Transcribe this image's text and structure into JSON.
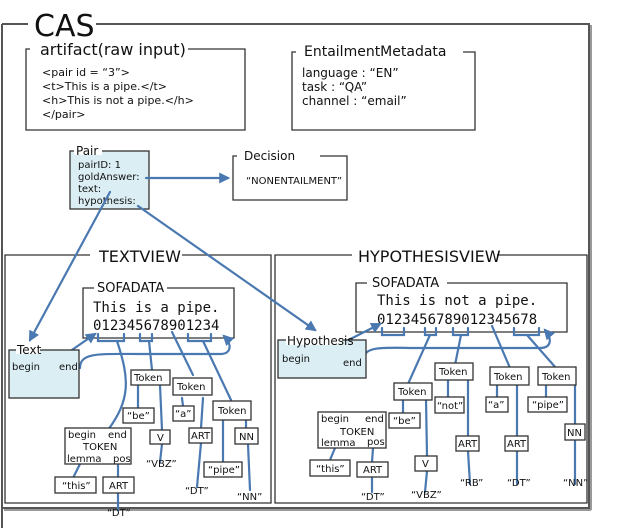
{
  "cas": {
    "title": "CAS"
  },
  "artifact": {
    "title": "artifact(raw input)",
    "lines": [
      "<pair id = “3”>",
      "<t>This is a pipe.</t>",
      "<h>This is not a pipe.</h>",
      "</pair>"
    ]
  },
  "metadata": {
    "title": "EntailmentMetadata",
    "lines": [
      "language : “EN”",
      "task : “QA”",
      "channel : “email”"
    ]
  },
  "pair": {
    "title": "Pair",
    "fields": [
      "pairID: 1",
      "goldAnswer:",
      "text:",
      "hypothesis:"
    ]
  },
  "decision": {
    "title": "Decision",
    "value": "“NONENTAILMENT”"
  },
  "textview": {
    "title": "TEXTVIEW",
    "sofa_title": "SOFADATA",
    "sofa_text": "This is a pipe.",
    "sofa_index": "012345678901234",
    "annotation": {
      "title": "Text",
      "begin": "begin",
      "end": "end"
    },
    "token_detail": {
      "begin": "begin",
      "end": "end",
      "type": "TOKEN",
      "lemma": "lemma",
      "pos": "pos"
    },
    "tokens": [
      {
        "label": "Token",
        "lemma": "“this”",
        "pos": "ART",
        "tag": "“DT”"
      },
      {
        "label": "Token",
        "lemma": "“be”",
        "pos": "V",
        "tag": "“VBZ”"
      },
      {
        "label": "Token",
        "lemma": "“a”",
        "pos": "ART",
        "tag": "“DT”"
      },
      {
        "label": "Token",
        "lemma": "“pipe”",
        "pos": "NN",
        "tag": "“NN”"
      }
    ]
  },
  "hypothesisview": {
    "title": "HYPOTHESISVIEW",
    "sofa_title": "SOFADATA",
    "sofa_text": "This is not a pipe.",
    "sofa_index": "0123456789012345678",
    "annotation": {
      "title": "Hypothesis",
      "begin": "begin",
      "end": "end"
    },
    "token_detail": {
      "begin": "begin",
      "end": "end",
      "type": "TOKEN",
      "lemma": "lemma",
      "pos": "pos"
    },
    "tokens": [
      {
        "label": "Token",
        "lemma": "“this”",
        "pos": "ART",
        "tag": "“DT”"
      },
      {
        "label": "Token",
        "lemma": "“be”",
        "pos": "V",
        "tag": "“VBZ”"
      },
      {
        "label": "Token",
        "lemma": "“not”",
        "pos": "ART",
        "tag": "“RB”"
      },
      {
        "label": "Token",
        "lemma": "“a”",
        "pos": "ART",
        "tag": "“DT”"
      },
      {
        "label": "Token",
        "lemma": "“pipe”",
        "pos": "NN",
        "tag": "“NN”"
      }
    ]
  },
  "colors": {
    "connector": "#4a78b0",
    "annotation_fill": "#dbeef4",
    "frame": "#555555"
  }
}
